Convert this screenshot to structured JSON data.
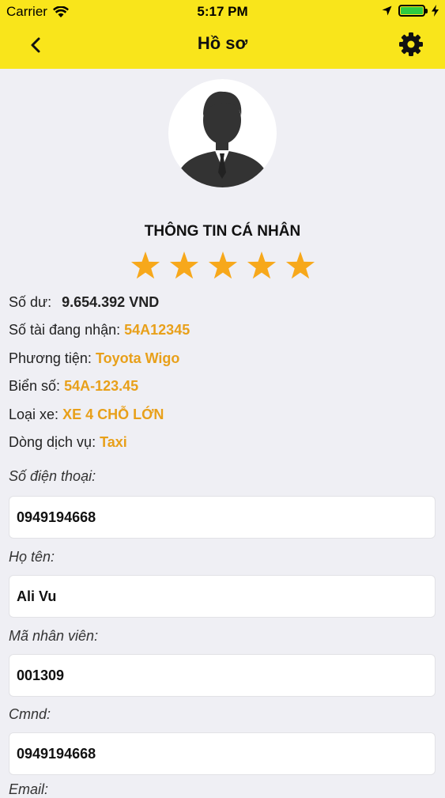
{
  "status_bar": {
    "carrier": "Carrier",
    "time": "5:17 PM",
    "battery_level": 1.0
  },
  "nav": {
    "title": "Hồ sơ",
    "back_icon": "chevron-left-icon",
    "settings_icon": "gear-icon"
  },
  "profile": {
    "avatar_icon": "user-avatar-icon",
    "section_title": "THÔNG TIN CÁ NHÂN",
    "rating": 5,
    "rating_max": 5,
    "star_color": "#f7a81b"
  },
  "info": {
    "balance_label": "Số dư:",
    "balance_value": "9.654.392 VND",
    "driver_code_label": "Số tài đang nhận:",
    "driver_code_value": "54A12345",
    "vehicle_label": "Phương tiện:",
    "vehicle_value": "Toyota Wigo",
    "plate_label": "Biển số:",
    "plate_value": "54A-123.45",
    "car_type_label": "Loại xe:",
    "car_type_value": "XE 4 CHỖ LỚN",
    "service_label": "Dòng dịch vụ:",
    "service_value": "Taxi",
    "accent_color": "#e8a01a"
  },
  "fields": {
    "phone_label": "Số điện thoại:",
    "phone_value": "0949194668",
    "name_label": "Họ tên:",
    "name_value": "Ali Vu",
    "employee_id_label": "Mã nhân viên:",
    "employee_id_value": "001309",
    "id_card_label": "Cmnd:",
    "id_card_value": "0949194668",
    "email_label": "Email:"
  },
  "colors": {
    "header": "#f9e51b",
    "background": "#efeff4"
  }
}
